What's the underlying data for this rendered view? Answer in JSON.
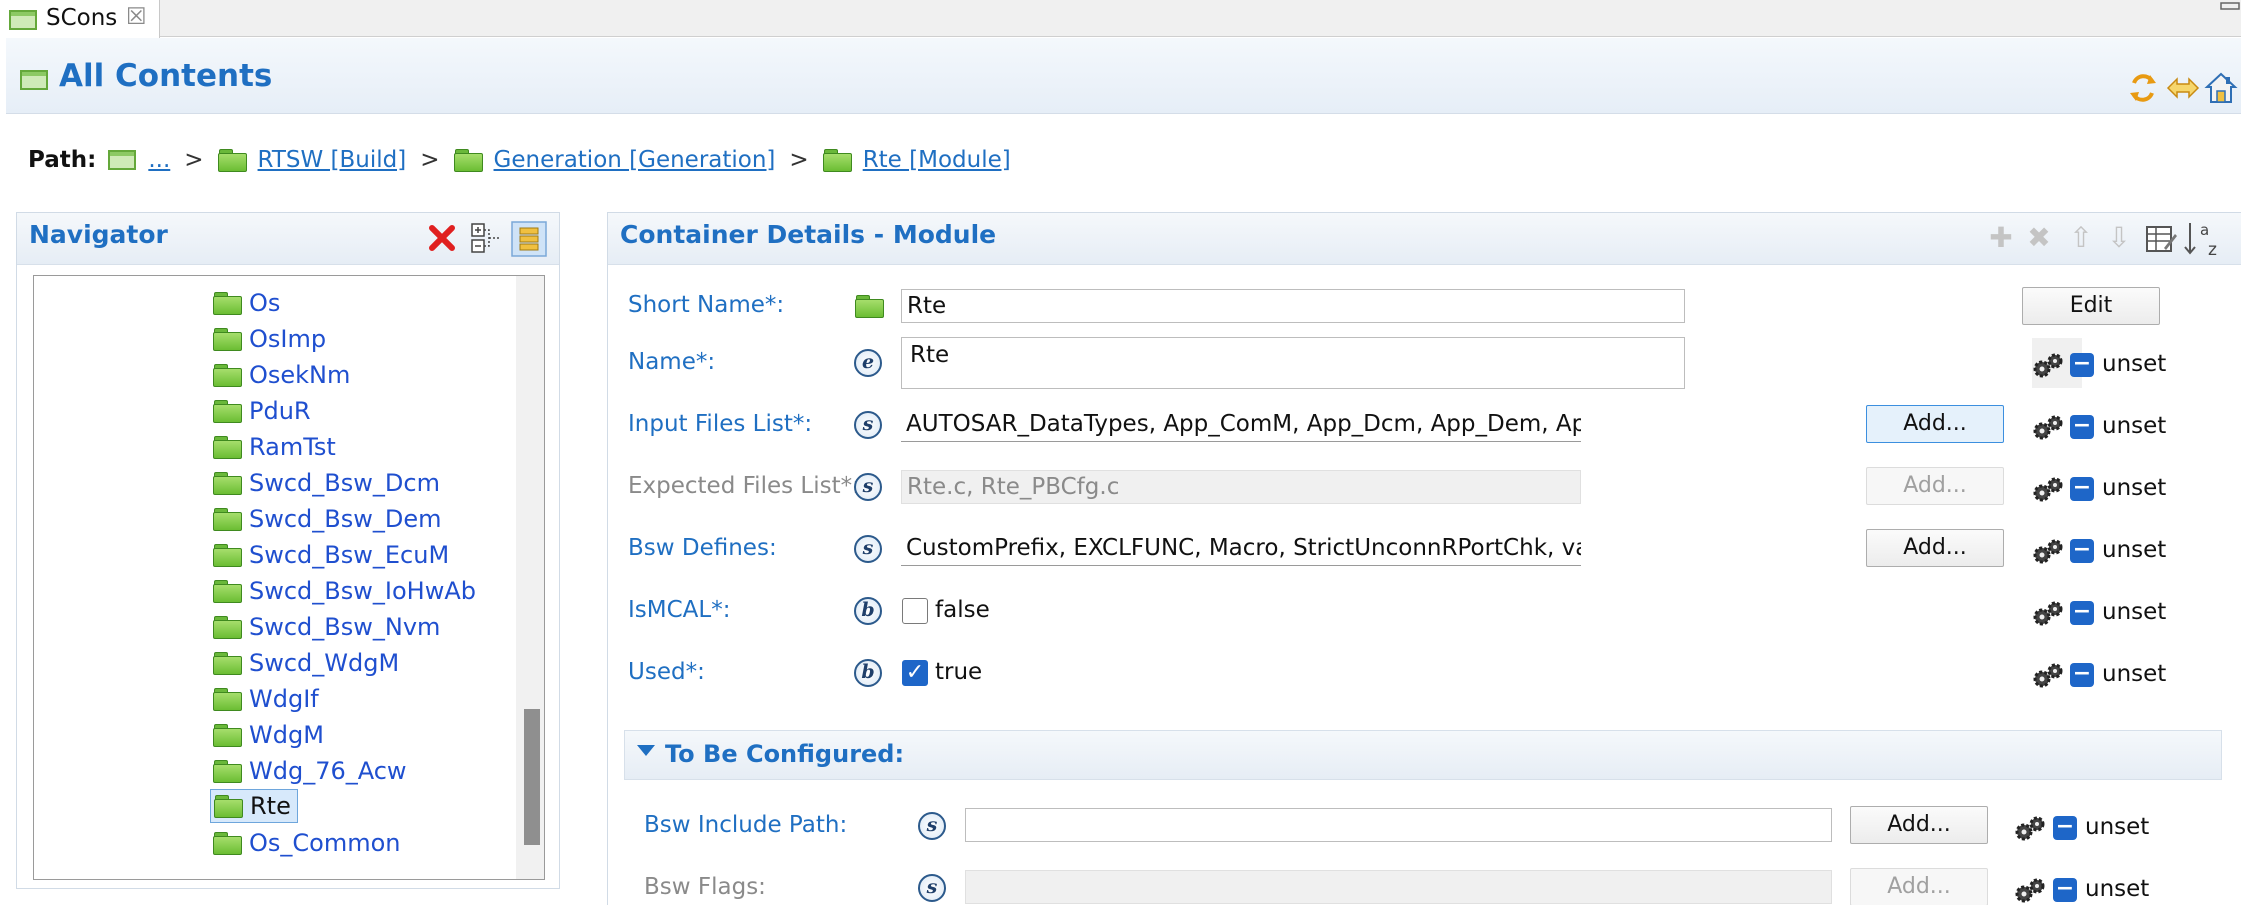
{
  "tab": {
    "title": "SCons",
    "close_glyph": "☒"
  },
  "banner": {
    "title": "All Contents"
  },
  "path": {
    "label": "Path:",
    "separator": ">",
    "items": [
      "...",
      "RTSW [Build]",
      "Generation [Generation]",
      "Rte [Module]"
    ]
  },
  "navigator": {
    "title": "Navigator",
    "items": [
      "Os",
      "OsImp",
      "OsekNm",
      "PduR",
      "RamTst",
      "Swcd_Bsw_Dcm",
      "Swcd_Bsw_Dem",
      "Swcd_Bsw_EcuM",
      "Swcd_Bsw_IoHwAb",
      "Swcd_Bsw_Nvm",
      "Swcd_WdgM",
      "WdgIf",
      "WdgM",
      "Wdg_76_Acw",
      "Rte",
      "Os_Common"
    ],
    "selected": "Rte"
  },
  "details": {
    "title": "Container Details - Module",
    "short_name": {
      "label": "Short Name*:",
      "value": "Rte",
      "button": "Edit"
    },
    "name": {
      "label": "Name*:",
      "icon_letter": "e",
      "value": "Rte",
      "unset": "unset"
    },
    "input_files": {
      "label": "Input Files List*:",
      "icon_letter": "s",
      "value": "AUTOSAR_DataTypes, App_ComM, App_Dcm, App_Dem, App_FiM, App_Lin, App_Mode,",
      "button": "Add...",
      "unset": "unset"
    },
    "expected_files": {
      "label": "Expected Files List*:",
      "icon_letter": "s",
      "value": "Rte.c, Rte_PBCfg.c",
      "button": "Add...",
      "unset": "unset"
    },
    "bsw_defines": {
      "label": "Bsw Defines:",
      "icon_letter": "s",
      "value": "CustomPrefix, EXCLFUNC, Macro, StrictUnconnRPortChk, validate, genmemmap, ErrorMs",
      "button": "Add...",
      "unset": "unset"
    },
    "is_mcal": {
      "label": "IsMCAL*:",
      "icon_letter": "b",
      "value": "false",
      "checked": false,
      "unset": "unset"
    },
    "used": {
      "label": "Used*:",
      "icon_letter": "b",
      "value": "true",
      "checked": true,
      "unset": "unset"
    }
  },
  "to_be_configured": {
    "title": "To Be Configured:",
    "bsw_include_path": {
      "label": "Bsw Include Path:",
      "icon_letter": "s",
      "value": "",
      "button": "Add...",
      "unset": "unset"
    },
    "bsw_flags": {
      "label": "Bsw Flags:",
      "icon_letter": "s",
      "value": "",
      "button": "Add...",
      "unset": "unset"
    }
  },
  "colors": {
    "accent": "#1f6fc2",
    "tree_text": "#1f4fcf",
    "unset_blue": "#1e66c8",
    "folder_green": "#6bbd33"
  }
}
